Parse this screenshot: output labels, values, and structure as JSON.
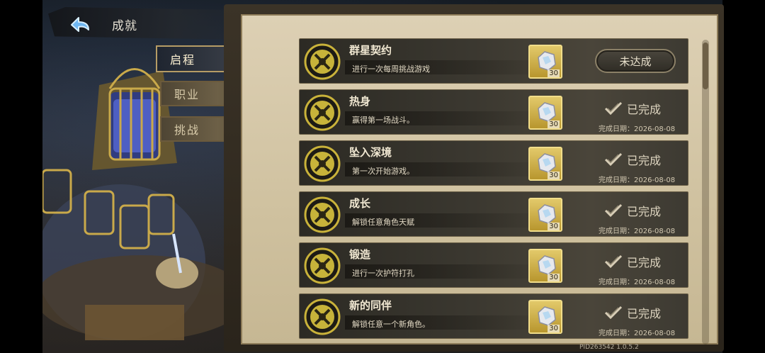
{
  "header": {
    "title": "成就",
    "back_icon": "back-arrow-icon"
  },
  "tabs": [
    {
      "label": "启程",
      "active": true
    },
    {
      "label": "职业",
      "active": false
    },
    {
      "label": "挑战",
      "active": false
    }
  ],
  "achievements": [
    {
      "title": "群星契约",
      "desc": "进行一次每周挑战游戏",
      "reward_count": "30",
      "status": "未达成",
      "completed": false,
      "date_label": ""
    },
    {
      "title": "热身",
      "desc": "赢得第一场战斗。",
      "reward_count": "30",
      "status": "已完成",
      "completed": true,
      "date_label": "完成日期：2026-08-08"
    },
    {
      "title": "坠入深境",
      "desc": "第一次开始游戏。",
      "reward_count": "30",
      "status": "已完成",
      "completed": true,
      "date_label": "完成日期：2026-08-08"
    },
    {
      "title": "成长",
      "desc": "解锁任意角色天赋",
      "reward_count": "30",
      "status": "已完成",
      "completed": true,
      "date_label": "完成日期：2026-08-08"
    },
    {
      "title": "锻造",
      "desc": "进行一次护符打孔",
      "reward_count": "30",
      "status": "已完成",
      "completed": true,
      "date_label": "完成日期：2026-08-08"
    },
    {
      "title": "新的同伴",
      "desc": "解锁任意一个新角色。",
      "reward_count": "30",
      "status": "已完成",
      "completed": true,
      "date_label": "完成日期：2026-08-08"
    }
  ],
  "footer": {
    "build": "PID263542  1.0.5.2"
  },
  "colors": {
    "accent_gold": "#c9a94a",
    "panel_parchment": "#d6c8a8",
    "row_dark": "#3b3830"
  }
}
